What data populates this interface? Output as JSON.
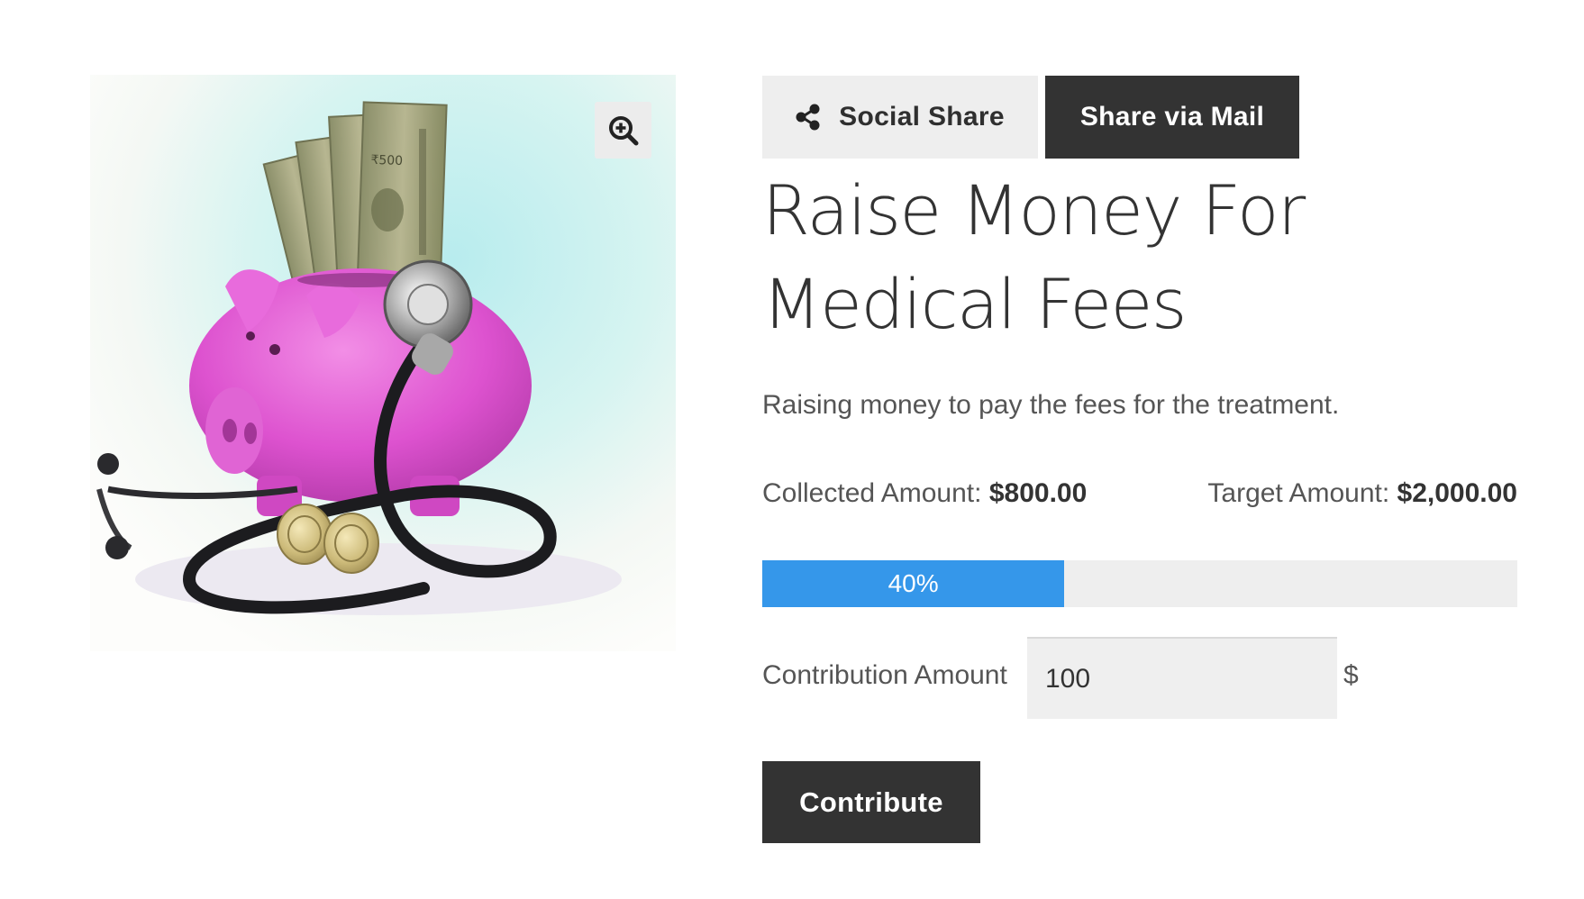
{
  "product": {
    "image_alt": "piggy bank with stethoscope and money",
    "zoom_icon": "zoom-in-icon"
  },
  "share": {
    "social_label": "Social Share",
    "social_icon": "share-nodes-icon",
    "mail_label": "Share via Mail"
  },
  "campaign": {
    "title": "Raise Money For Medical Fees",
    "description": "Raising money to pay the fees for the treatment.",
    "collected_label": "Collected Amount:",
    "collected_value": "$800.00",
    "target_label": "Target Amount:",
    "target_value": "$2,000.00",
    "progress_percent": 40,
    "progress_label": "40%"
  },
  "contribution": {
    "label": "Contribution Amount",
    "value": "100",
    "currency": "$",
    "button_label": "Contribute"
  },
  "colors": {
    "accent": "#3597ea",
    "dark_button": "#333333",
    "light_button": "#eeeeee"
  }
}
